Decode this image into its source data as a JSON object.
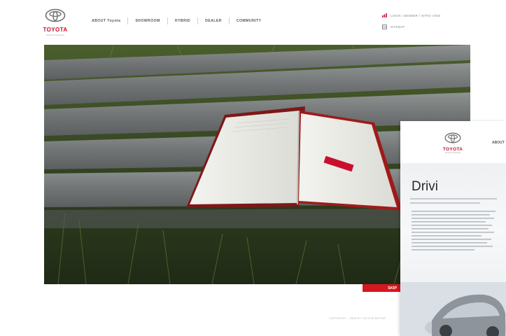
{
  "brand": {
    "name": "TOYOTA",
    "tagline": "Smile for Tomorrow",
    "accent": "#c8102e"
  },
  "nav": {
    "items": [
      "ABOUT Toyota",
      "SHOWROOM",
      "HYBRID",
      "DEALER",
      "COMMUNITY"
    ]
  },
  "utility": {
    "login_links": "LOGIN / MEMBER / INTRO VIEW",
    "sitemap": "SITEMAP"
  },
  "hero": {
    "skip_label": "SKIP"
  },
  "footer": {
    "copyright": "COPYRIGHT · 2008 BY TOYOTA MOTOR"
  },
  "overlay": {
    "nav_first": "ABOUT",
    "headline": "Drivi"
  }
}
